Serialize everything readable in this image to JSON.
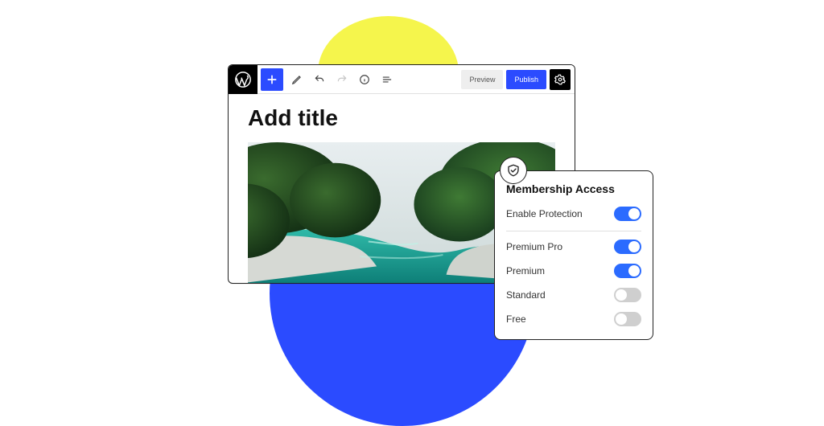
{
  "toolbar": {
    "preview_label": "Preview",
    "publish_label": "Publish"
  },
  "editor": {
    "title_placeholder": "Add title"
  },
  "popover": {
    "heading": "Membership Access",
    "enable_label": "Enable Protection",
    "tiers": [
      {
        "label": "Premium Pro",
        "on": true
      },
      {
        "label": "Premium",
        "on": true
      },
      {
        "label": "Standard",
        "on": false
      },
      {
        "label": "Free",
        "on": false
      }
    ]
  }
}
